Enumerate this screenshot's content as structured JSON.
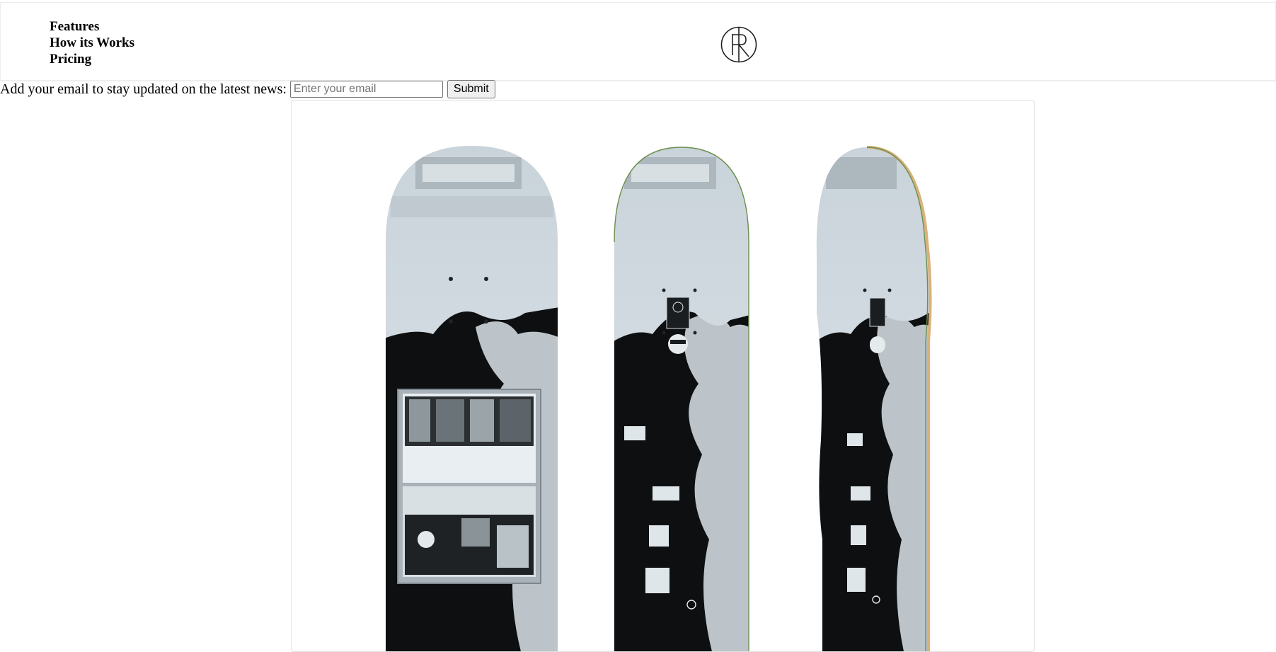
{
  "nav": {
    "items": [
      {
        "label": "Features"
      },
      {
        "label": "How its Works"
      },
      {
        "label": "Pricing"
      }
    ]
  },
  "logo": {
    "icon": "polar-logo-icon"
  },
  "signup": {
    "label": "Add your email to stay updated on the latest news:",
    "placeholder": "Enter your email",
    "value": "",
    "submit_label": "Submit"
  },
  "product": {
    "image": "three-skateboard-decks",
    "colors": {
      "deck_light": "#cdd6dc",
      "deck_dark": "#0d0f10",
      "deck_edge_green": "#6b8f4e",
      "deck_edge_wood": "#d9b27a"
    }
  }
}
